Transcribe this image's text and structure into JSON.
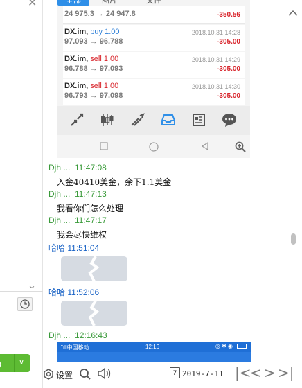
{
  "phone_app": {
    "tabs": [
      "全部",
      "图片",
      "文件"
    ],
    "trades": [
      {
        "symbol": "",
        "direction": "",
        "price": "24 975.3 → 24 947.8",
        "time": "",
        "pnl": "-350.56"
      },
      {
        "symbol": "DX.im,",
        "direction": "buy 1.00",
        "price": "97.093 → 96.788",
        "time": "2018.10.31 14:28",
        "pnl": "-305.00"
      },
      {
        "symbol": "DX.im,",
        "direction": "sell 1.00",
        "price": "96.788 → 97.093",
        "time": "2018.10.31 14:29",
        "pnl": "-305.00"
      },
      {
        "symbol": "DX.im,",
        "direction": "sell 1.00",
        "price": "96.793 → 97.098",
        "time": "2018.10.31 14:30",
        "pnl": "-305.00"
      }
    ],
    "toolbar_icons": [
      "trade-arrows-icon",
      "candlestick-icon",
      "trend-icon",
      "inbox-icon",
      "news-icon",
      "chat-bubble-icon"
    ],
    "navbar_icons": [
      "square-icon",
      "circle-icon",
      "back-triangle-icon",
      "zoom-in-icon"
    ]
  },
  "messages": [
    {
      "sender": "Djh ...",
      "time": "11:47:08",
      "text": "入金40410美金，余下1.1美金"
    },
    {
      "sender": "Djh ...",
      "time": "11:47:13",
      "text": "我看你们怎么处理"
    },
    {
      "sender": "Djh ...",
      "time": "11:47:17",
      "text": "我会尽快维权"
    },
    {
      "sender": "哈哈",
      "time": "11:51:04",
      "text": ""
    },
    {
      "sender": "哈哈",
      "time": "11:52:06",
      "text": ""
    },
    {
      "sender": "Djh ...",
      "time": "12:16:43",
      "text": ""
    }
  ],
  "phone2_status": {
    "carrier": "\"ıll中国移动",
    "time": "12:16"
  },
  "bottom": {
    "settings_label": "设置",
    "calendar_day": "7",
    "date": "2019-7-11"
  },
  "colors": {
    "accent_blue": "#2f8fe8",
    "loss_red": "#d8232a",
    "sender_green": "#3a9a3a",
    "sender_blue": "#1a63c6",
    "send_green": "#5dbb33"
  }
}
